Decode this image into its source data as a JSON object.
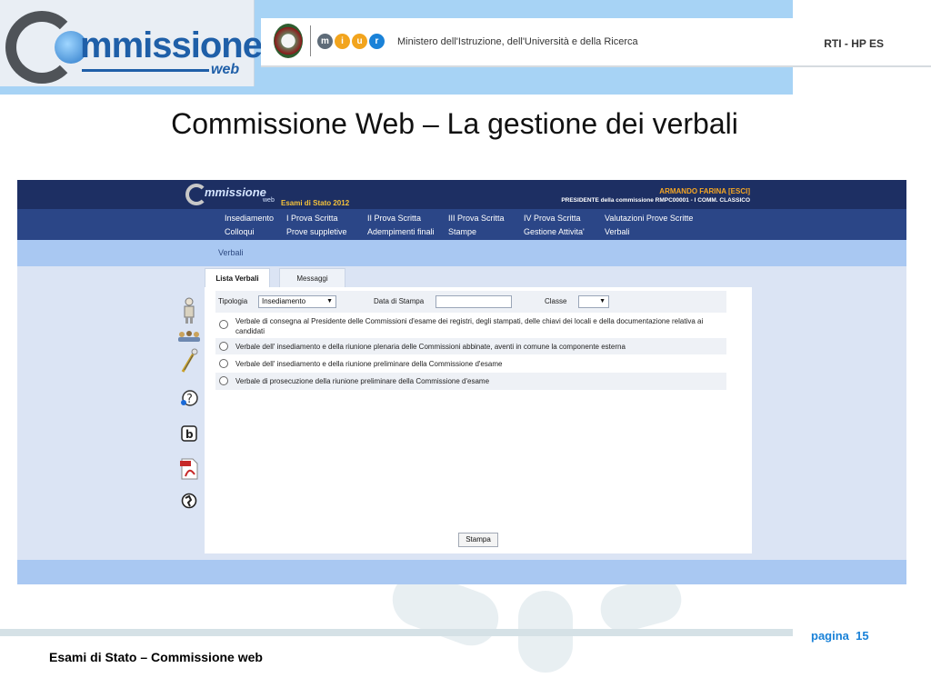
{
  "slide": {
    "title": "Commissione Web – La gestione dei verbali",
    "footer": "Esami di Stato – Commissione web",
    "page_label": "pagina",
    "page_number": "15"
  },
  "header": {
    "logo_text": "mmissione",
    "logo_sub": "web",
    "miur_letters": [
      "m",
      "i",
      "u",
      "r"
    ],
    "miur_colors": [
      "#5e6b78",
      "#f2a41d",
      "#f2a41d",
      "#1a82d8"
    ],
    "ministry": "Ministero dell'Istruzione, dell'Università e della Ricerca",
    "rti": "RTI - HP ES"
  },
  "app": {
    "logo_text": "mmissione",
    "logo_sub": "web",
    "esami": "Esami di Stato 2012",
    "user_name": "ARMANDO FARINA [ESCI]",
    "user_role": "PRESIDENTE della commissione RMPC00001 - I COMM. CLASSICO",
    "menu_row1": [
      "Insediamento",
      "I Prova Scritta",
      "II Prova Scritta",
      "III Prova Scritta",
      "IV Prova Scritta",
      "Valutazioni Prove Scritte"
    ],
    "menu_row2": [
      "Colloqui",
      "Prove suppletive",
      "Adempimenti finali",
      "Stampe",
      "Gestione Attivita'",
      "Verbali"
    ],
    "sub_item": "Verbali",
    "tabs": [
      "Lista Verbali",
      "Messaggi"
    ],
    "filters": {
      "tipologia_label": "Tipologia",
      "tipologia_value": "Insediamento",
      "data_label": "Data di Stampa",
      "data_value": "",
      "classe_label": "Classe",
      "classe_value": ""
    },
    "verbali": [
      "Verbale di consegna al Presidente delle Commissioni d'esame dei registri, degli stampati, delle chiavi dei locali e della documentazione relativa ai candidati",
      "Verbale dell' insediamento e della riunione plenaria delle Commissioni abbinate, aventi in comune la componente esterna",
      "Verbale dell' insediamento e della riunione preliminare della Commissione d'esame",
      "Verbale di prosecuzione della riunione preliminare della Commissione d'esame"
    ],
    "stampa_label": "Stampa",
    "side_icons": [
      "user-figure-icon",
      "crowd-icon",
      "tools-icon",
      "help-icon",
      "b-badge-icon",
      "pdf-icon",
      "globe-icon"
    ]
  }
}
